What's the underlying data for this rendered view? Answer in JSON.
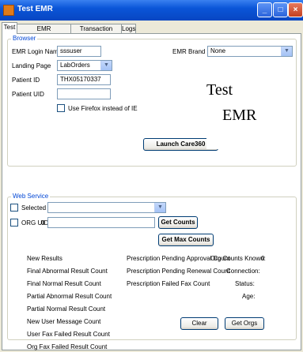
{
  "window": {
    "title": "Test EMR"
  },
  "tabs": [
    "Test",
    "EMR Configuration",
    "Transaction Payload",
    "Logs"
  ],
  "browser": {
    "legend": "Browser",
    "login_label": "EMR Login Name",
    "login_value": "sssuser",
    "landing_label": "Landing Page",
    "landing_value": "LabOrders",
    "patient_id_label": "Patient ID",
    "patient_id_value": "THX05170337",
    "patient_uid_label": "Patient UID",
    "patient_uid_value": "",
    "firefox_label": "Use Firefox instead of IE",
    "brand_label": "EMR Brand",
    "brand_value": "None",
    "logo_line1": "Test",
    "logo_line2": "EMR",
    "launch_label": "Launch Care360"
  },
  "web_service": {
    "legend": "Web Service",
    "selected_org_label": "Selected Org:",
    "org_uid_label": "ORG UID:",
    "org_uid_value": "0",
    "get_counts_label": "Get Counts",
    "get_max_counts_label": "Get Max Counts",
    "counts_col1": [
      "New Results",
      "Final Abnormal Result Count",
      "Final Normal Result Count",
      "Partial Abnormal Result Count",
      "Partial Normal Result Count",
      "New User Message Count",
      "User Fax Failed Result Count",
      "Org Fax Failed Result Count"
    ],
    "counts_col2": [
      "Prescription Pending Approval Count",
      "Prescription Pending Renewal Count",
      "Prescription Failed Fax Count"
    ],
    "org_counts_known_label": "Org Counts Known:",
    "org_counts_known_value": "0",
    "connection_label": "Connection:",
    "status_label": "Status:",
    "age_label": "Age:",
    "clear_label": "Clear",
    "get_orgs_label": "Get Orgs"
  }
}
